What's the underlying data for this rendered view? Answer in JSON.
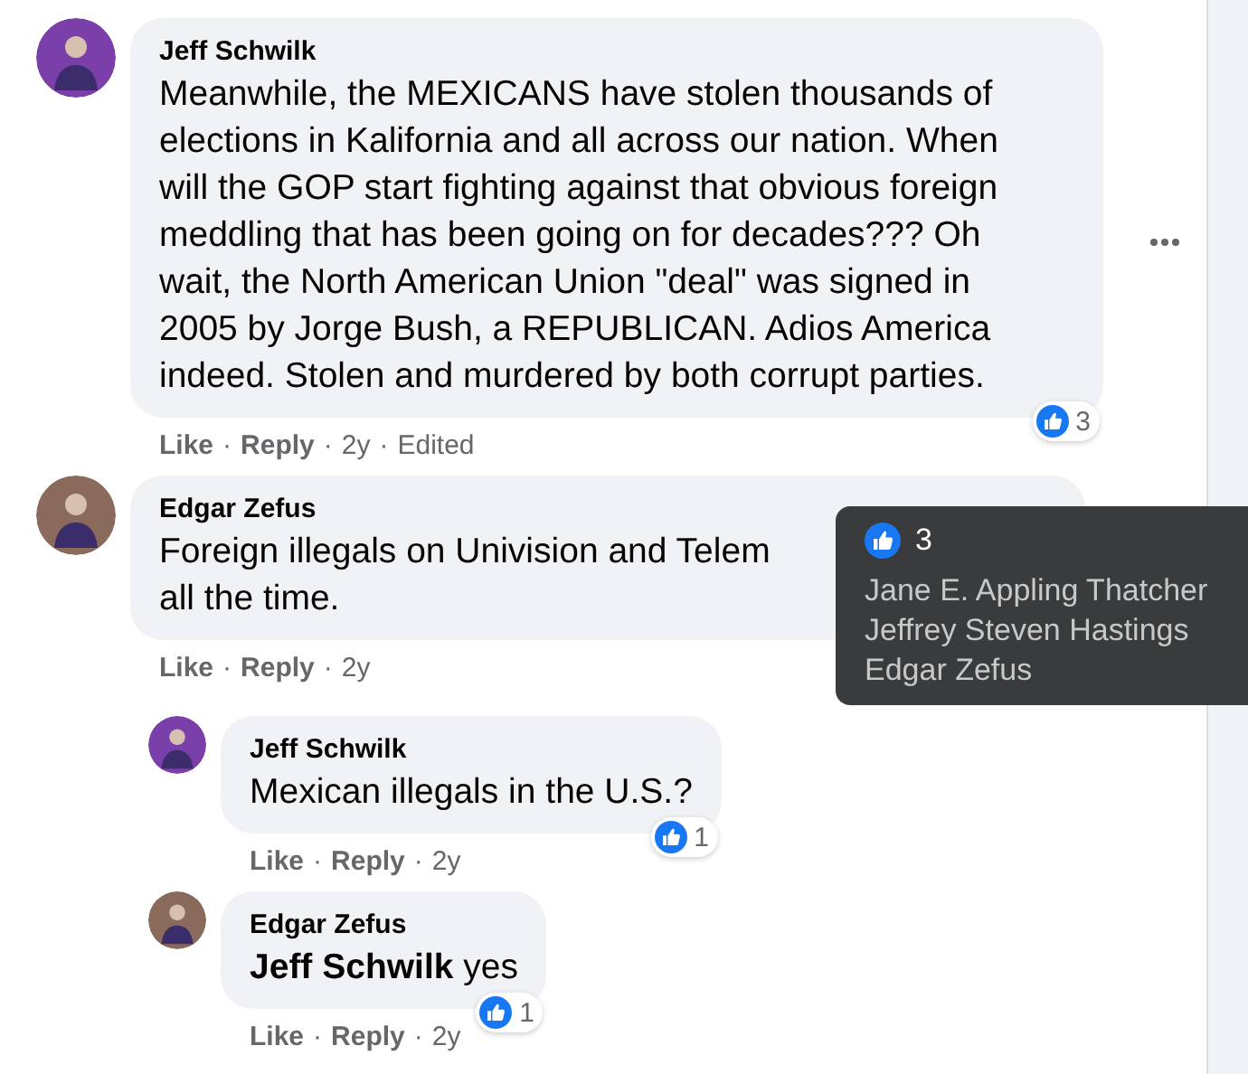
{
  "separator": "·",
  "comments": [
    {
      "author": "Jeff Schwilk",
      "color": "#7a3fa8",
      "text": "Meanwhile, the MEXICANS have stolen thousands of elections in Kalifornia and all across our nation. When will the GOP start fighting against that obvious foreign meddling that has been going on for decades??? Oh wait, the North American Union \"deal\" was signed in 2005 by Jorge Bush, a REPUBLICAN. Adios America indeed. Stolen and murdered by both corrupt parties.",
      "actions": [
        "Like",
        "Reply"
      ],
      "time": "2y",
      "edited": "Edited",
      "reactions": "3",
      "menu": true
    },
    {
      "author": "Edgar Zefus",
      "color": "#8a6a5a",
      "text": "Foreign illegals on Univision and Telem\nall the time.",
      "actions": [
        "Like",
        "Reply"
      ],
      "time": "2y",
      "menu": false,
      "replies": [
        {
          "author": "Jeff Schwilk",
          "color": "#7a3fa8",
          "text": "Mexican illegals in the U.S.?",
          "actions": [
            "Like",
            "Reply"
          ],
          "time": "2y",
          "reactions": "1"
        },
        {
          "author": "Edgar Zefus",
          "color": "#8a6a5a",
          "text": "**Jeff Schwilk** yes",
          "actions": [
            "Like",
            "Reply"
          ],
          "time": "2y",
          "reactions": "1"
        }
      ]
    }
  ],
  "tooltip": {
    "count": "3",
    "names": [
      "Jane E. Appling Thatcher",
      "Jeffrey Steven Hastings",
      "Edgar Zefus"
    ]
  }
}
